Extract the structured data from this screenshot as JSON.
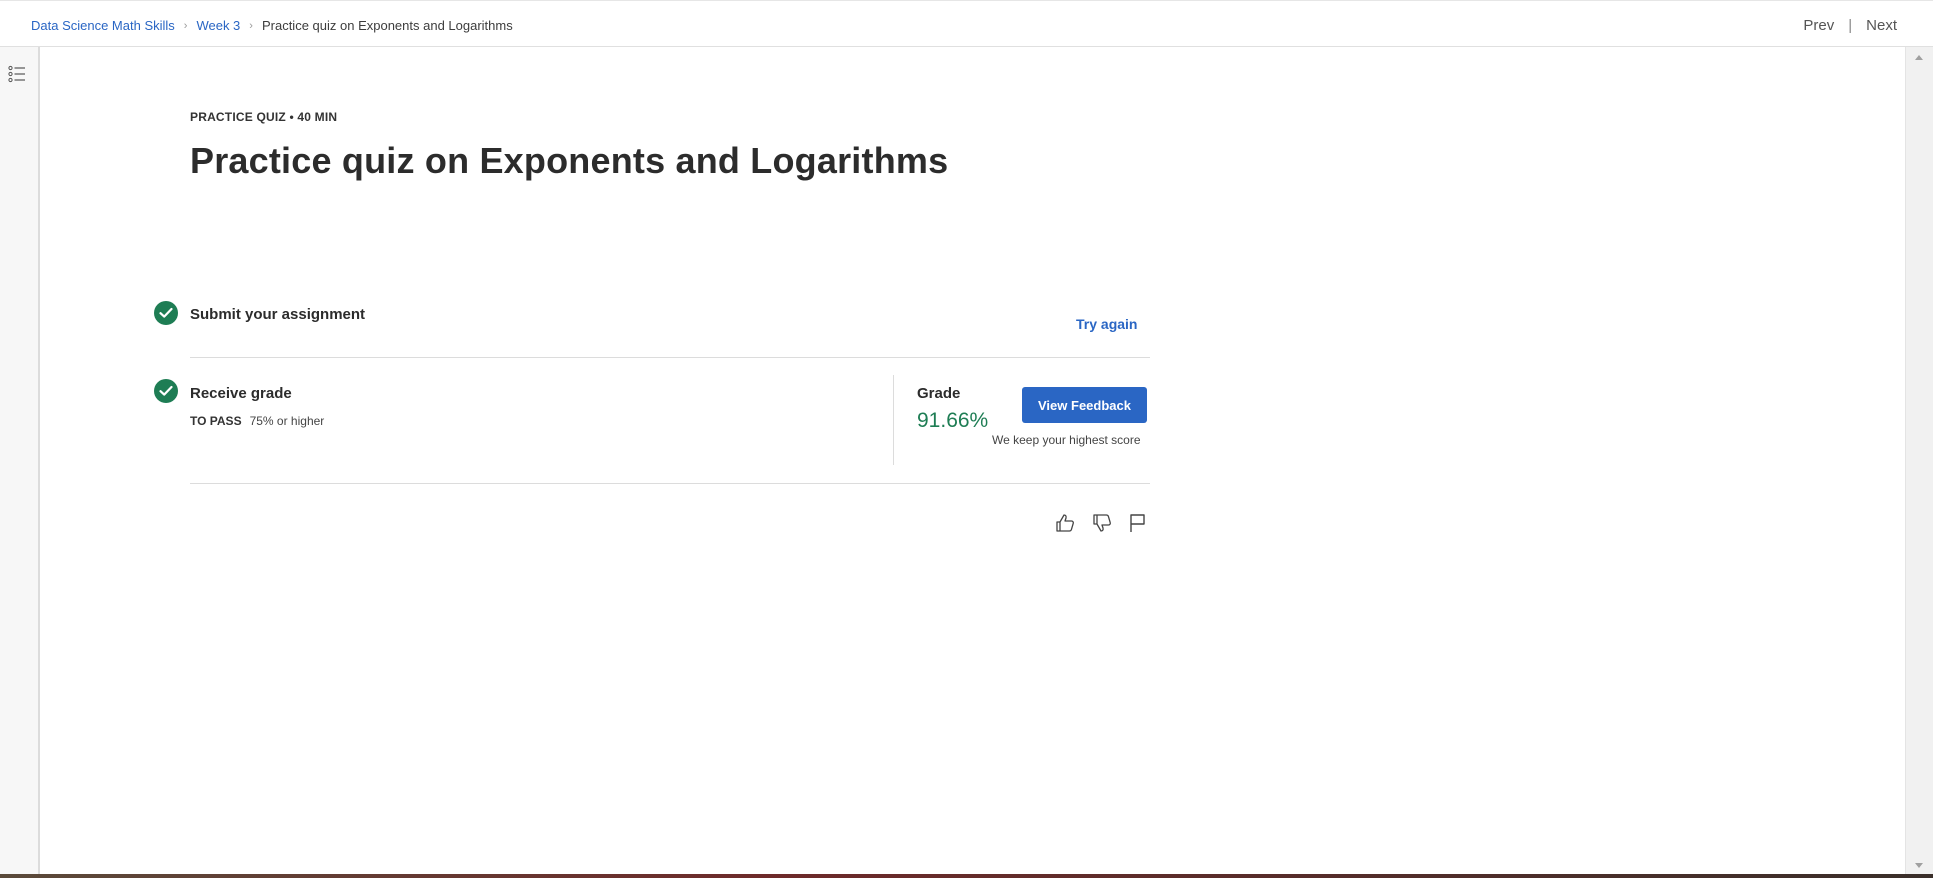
{
  "breadcrumb": {
    "items": [
      {
        "label": "Data Science Math Skills"
      },
      {
        "label": "Week 3"
      },
      {
        "label": "Practice quiz on Exponents and Logarithms"
      }
    ]
  },
  "nav": {
    "prev": "Prev",
    "divider": "|",
    "next": "Next"
  },
  "rail": {
    "toc_icon": "list-icon"
  },
  "header": {
    "kicker": "PRACTICE QUIZ • 40 MIN",
    "title": "Practice quiz on Exponents and Logarithms"
  },
  "steps": {
    "submit": {
      "label": "Submit your assignment",
      "action": "Try again",
      "status": "complete"
    },
    "receive": {
      "label": "Receive grade",
      "to_pass_label": "TO PASS",
      "to_pass_value": "75% or higher",
      "status": "complete"
    }
  },
  "grade": {
    "label": "Grade",
    "value": "91.66%",
    "button": "View Feedback",
    "note": "We keep your highest score"
  },
  "feedback_icons": [
    "thumbs-up-icon",
    "thumbs-down-icon",
    "flag-icon"
  ],
  "colors": {
    "accent": "#2a66c4",
    "success": "#1e7d54",
    "text": "#2c2c2c"
  }
}
